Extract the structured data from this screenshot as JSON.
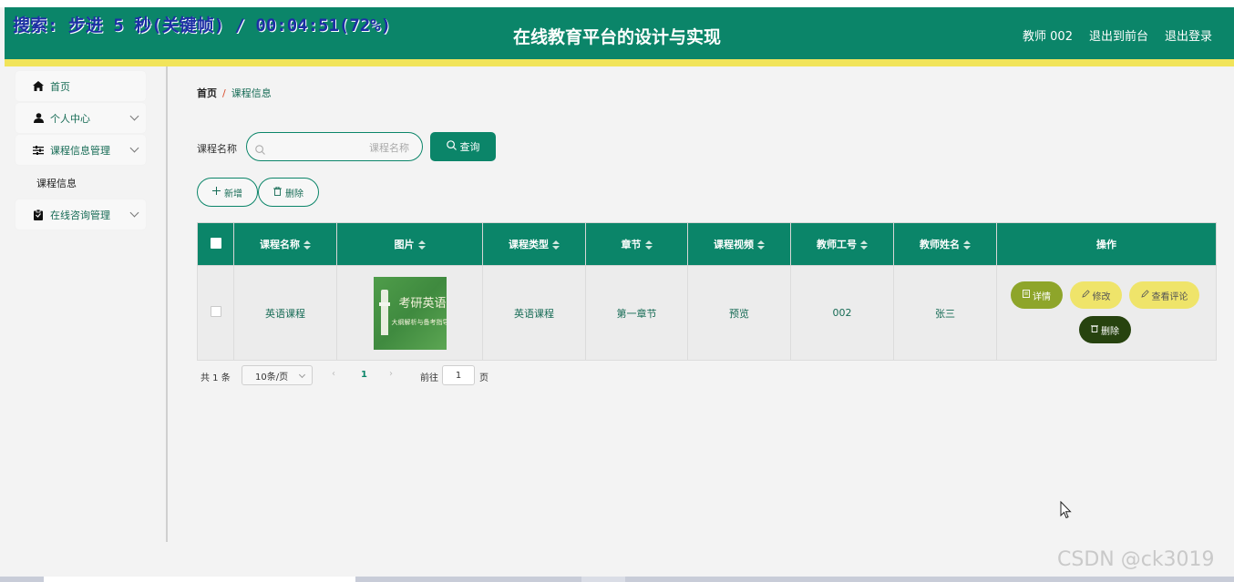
{
  "overlay_text": "搜索: 步进 5 秒(关键帧) / 00:04:51(72%)",
  "header": {
    "title": "在线教育平台的设计与实现",
    "user": "教师 002",
    "to_front": "退出到前台",
    "logout": "退出登录"
  },
  "sidebar": {
    "items": [
      {
        "label": "首页",
        "icon": "home-icon"
      },
      {
        "label": "个人中心",
        "icon": "user-icon"
      },
      {
        "label": "课程信息管理",
        "icon": "sliders-icon"
      },
      {
        "label": "在线咨询管理",
        "icon": "clipboard-icon"
      }
    ],
    "submenu_item": "课程信息"
  },
  "breadcrumb": {
    "home": "首页",
    "sep": "/",
    "current": "课程信息"
  },
  "search": {
    "label": "课程名称",
    "placeholder": "课程名称",
    "button": "查询"
  },
  "actions": {
    "add": "新增",
    "delete": "删除"
  },
  "table": {
    "headers": [
      "课程名称",
      "图片",
      "课程类型",
      "章节",
      "课程视频",
      "教师工号",
      "教师姓名",
      "操作"
    ],
    "rows": [
      {
        "course_name": "英语课程",
        "image_title": "考研英语",
        "image_subtitle": "大纲解析与备考指导",
        "course_type": "英语课程",
        "chapter": "第一章节",
        "video": "预览",
        "teacher_no": "002",
        "teacher_name": "张三",
        "ops": {
          "detail": "详情",
          "edit": "修改",
          "comments": "查看评论",
          "delete": "删除"
        }
      }
    ]
  },
  "pagination": {
    "total": "共 1 条",
    "page_size": "10条/页",
    "current_page": "1",
    "goto_label": "前往",
    "goto_value": "1",
    "page_suffix": "页"
  },
  "watermark": "CSDN @ck3019",
  "colors": {
    "primary": "#0b8569",
    "accent_line": "#f1e45a",
    "detail_btn": "#8ea52a",
    "edit_btn": "#efe46a",
    "delete_btn": "#27430f"
  }
}
